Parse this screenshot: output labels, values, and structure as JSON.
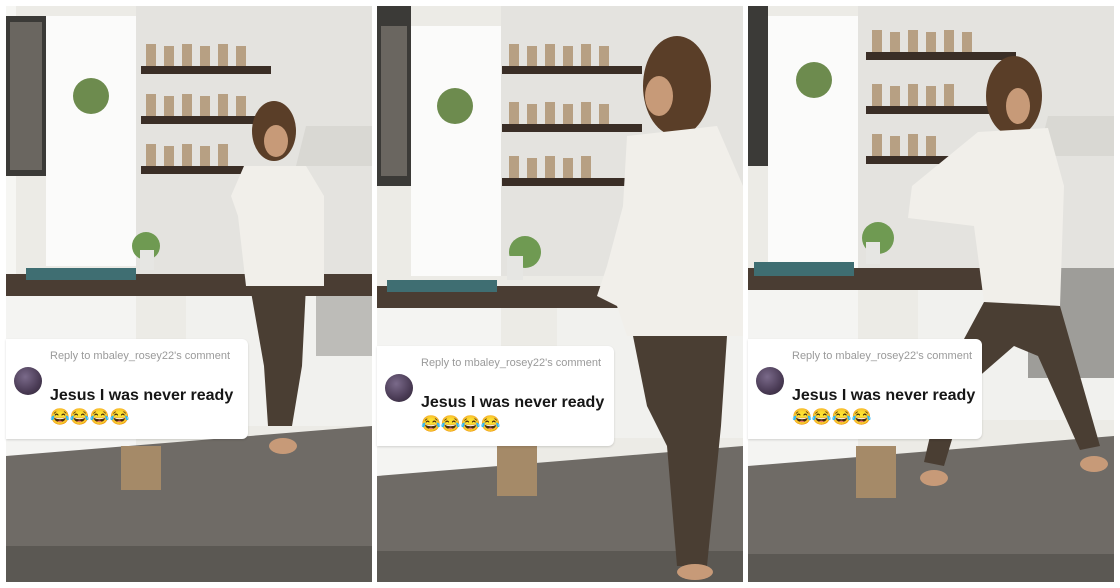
{
  "panels": [
    {
      "id": "left"
    },
    {
      "id": "middle"
    },
    {
      "id": "right"
    }
  ],
  "reply": {
    "label": "Reply to mbaley_rosey22's comment",
    "comment": "Jesus I was never ready😂😂😂😂"
  },
  "colors": {
    "wall": "#ecebe6",
    "shelf": "#3a2e26",
    "counter_top": "#4a3d33",
    "cabinet": "#f4f4f2",
    "floor": "#6f6b66",
    "shirt": "#f1efea",
    "trousers": "#4a3e33",
    "hair": "#5a3e28",
    "skin": "#c79a78"
  }
}
